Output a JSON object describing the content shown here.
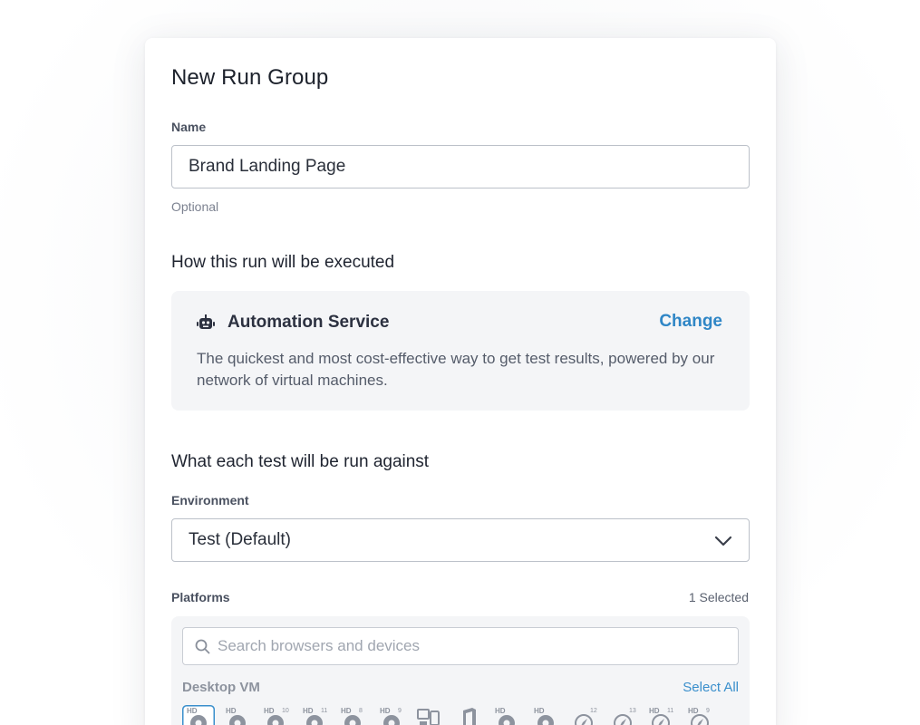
{
  "dialog": {
    "title": "New Run Group",
    "name_label": "Name",
    "name_value": "Brand Landing Page",
    "name_hint": "Optional"
  },
  "execution": {
    "heading": "How this run will be executed",
    "service_name": "Automation Service",
    "service_icon": "robot-icon",
    "change_label": "Change",
    "service_description": "The quickest and most cost-effective way to get test results, powered by our network of virtual machines."
  },
  "target": {
    "heading": "What each test will be run against",
    "environment_label": "Environment",
    "environment_value": "Test (Default)"
  },
  "platforms": {
    "label": "Platforms",
    "selected_count": "1 Selected",
    "search_placeholder": "Search browsers and devices",
    "group_label": "Desktop VM",
    "select_all_label": "Select All",
    "icons": [
      {
        "name": "chrome-hd-icon",
        "badge": "HD",
        "version": "",
        "selected": true
      },
      {
        "name": "firefox-hd-icon",
        "badge": "HD",
        "version": "",
        "selected": false
      },
      {
        "name": "ie10-hd-icon",
        "badge": "HD",
        "version": "10",
        "selected": false
      },
      {
        "name": "ie11-hd-icon",
        "badge": "HD",
        "version": "11",
        "selected": false
      },
      {
        "name": "ie8-hd-icon",
        "badge": "HD",
        "version": "8",
        "selected": false
      },
      {
        "name": "ie9-hd-icon",
        "badge": "HD",
        "version": "9",
        "selected": false
      },
      {
        "name": "edge-device-icon",
        "badge": "",
        "version": "",
        "selected": false
      },
      {
        "name": "office-icon",
        "badge": "",
        "version": "",
        "selected": false
      },
      {
        "name": "chrome-mac-hd-icon",
        "badge": "HD",
        "version": "",
        "selected": false
      },
      {
        "name": "firefox-mac-hd-icon",
        "badge": "HD",
        "version": "",
        "selected": false
      },
      {
        "name": "safari12-icon",
        "badge": "",
        "version": "12",
        "selected": false
      },
      {
        "name": "safari13-icon",
        "badge": "",
        "version": "13",
        "selected": false
      },
      {
        "name": "safari11-hd-icon",
        "badge": "HD",
        "version": "11",
        "selected": false
      },
      {
        "name": "safari9-hd-icon",
        "badge": "HD",
        "version": "9",
        "selected": false
      }
    ]
  },
  "colors": {
    "accent": "#2f86c6",
    "panel_bg": "#f4f5f7",
    "border": "#bcc1c9"
  }
}
